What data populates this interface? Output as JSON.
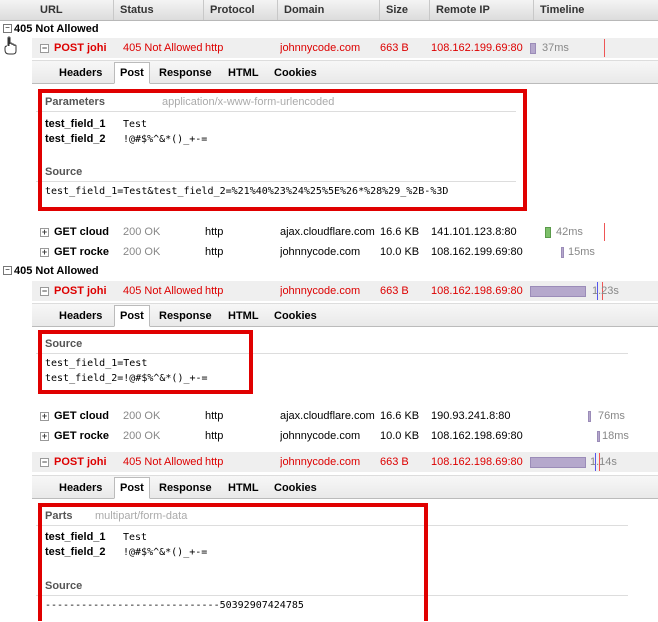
{
  "columns": [
    "URL",
    "Status",
    "Protocol",
    "Domain",
    "Size",
    "Remote IP",
    "Timeline"
  ],
  "groups": [
    {
      "title": "405 Not Allowed"
    },
    {
      "title": "405 Not Allowed"
    }
  ],
  "requests": [
    {
      "method_url": "POST johi",
      "status": "405 Not Allowed",
      "protocol": "http",
      "domain": "johnnycode.com",
      "size": "663 B",
      "ip": "108.162.199.69:80",
      "time": "37ms",
      "toggle": "−"
    },
    {
      "method_url": "GET cloud",
      "status": "200 OK",
      "protocol": "http",
      "domain": "ajax.cloudflare.com",
      "size": "16.6 KB",
      "ip": "141.101.123.8:80",
      "time": "42ms",
      "toggle": "+"
    },
    {
      "method_url": "GET rocke",
      "status": "200 OK",
      "protocol": "http",
      "domain": "johnnycode.com",
      "size": "10.0 KB",
      "ip": "108.162.199.69:80",
      "time": "15ms",
      "toggle": "+"
    },
    {
      "method_url": "POST johi",
      "status": "405 Not Allowed",
      "protocol": "http",
      "domain": "johnnycode.com",
      "size": "663 B",
      "ip": "108.162.198.69:80",
      "time": "1.23s",
      "toggle": "−"
    },
    {
      "method_url": "GET cloud",
      "status": "200 OK",
      "protocol": "http",
      "domain": "ajax.cloudflare.com",
      "size": "16.6 KB",
      "ip": "190.93.241.8:80",
      "time": "76ms",
      "toggle": "+"
    },
    {
      "method_url": "GET rocke",
      "status": "200 OK",
      "protocol": "http",
      "domain": "johnnycode.com",
      "size": "10.0 KB",
      "ip": "108.162.198.69:80",
      "time": "18ms",
      "toggle": "+"
    },
    {
      "method_url": "POST johi",
      "status": "405 Not Allowed",
      "protocol": "http",
      "domain": "johnnycode.com",
      "size": "663 B",
      "ip": "108.162.198.69:80",
      "time": "1.14s",
      "toggle": "−"
    }
  ],
  "tabs": [
    "Headers",
    "Post",
    "Response",
    "HTML",
    "Cookies"
  ],
  "panel1": {
    "params_title": "Parameters",
    "params_type": "application/x-www-form-urlencoded",
    "params": [
      {
        "name": "test_field_1",
        "value": "Test"
      },
      {
        "name": "test_field_2",
        "value": "!@#$%^&*()_+-="
      }
    ],
    "source_title": "Source",
    "source": "test_field_1=Test&test_field_2=%21%40%23%24%25%5E%26*%28%29_%2B-%3D"
  },
  "panel2": {
    "source_title": "Source",
    "line1": "test_field_1=Test",
    "line2": "test_field_2=!@#$%^&*()_+-="
  },
  "panel3": {
    "parts_title": "Parts",
    "parts_type": "multipart/form-data",
    "params": [
      {
        "name": "test_field_1",
        "value": "Test"
      },
      {
        "name": "test_field_2",
        "value": "!@#$%^&*()_+-="
      }
    ],
    "source_title": "Source",
    "source": "-----------------------------50392907424785"
  },
  "colors": {
    "error": "#dd0000",
    "highlight": "#e00000",
    "timeline_bar": "#b5a8cc"
  }
}
